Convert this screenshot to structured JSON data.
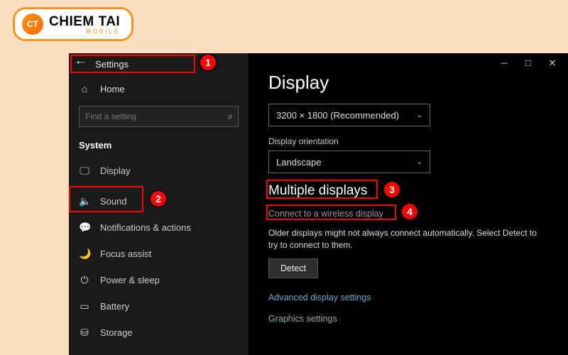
{
  "logo": {
    "badge": "CT",
    "main": "CHIEM TAI",
    "sub": "MOBILE"
  },
  "sidebar": {
    "back_label": "Settings",
    "home_label": "Home",
    "search_placeholder": "Find a setting",
    "category": "System",
    "items": [
      {
        "label": "Display",
        "icon": "🖵"
      },
      {
        "label": "Sound",
        "icon": "🔈"
      },
      {
        "label": "Notifications & actions",
        "icon": "💬"
      },
      {
        "label": "Focus assist",
        "icon": "🌙"
      },
      {
        "label": "Power & sleep",
        "icon": "⏻"
      },
      {
        "label": "Battery",
        "icon": "▭"
      },
      {
        "label": "Storage",
        "icon": "⛁"
      }
    ]
  },
  "main": {
    "title": "Display",
    "resolution": "3200 × 1800 (Recommended)",
    "orientation_label": "Display orientation",
    "orientation_value": "Landscape",
    "multi_title": "Multiple displays",
    "wireless_link": "Connect to a wireless display",
    "desc": "Older displays might not always connect automatically. Select Detect to try to connect to them.",
    "detect_btn": "Detect",
    "adv_link": "Advanced display settings",
    "gfx_link": "Graphics settings"
  },
  "badges": {
    "b1": "1",
    "b2": "2",
    "b3": "3",
    "b4": "4"
  },
  "win": {
    "min": "─",
    "max": "□",
    "close": "✕"
  }
}
